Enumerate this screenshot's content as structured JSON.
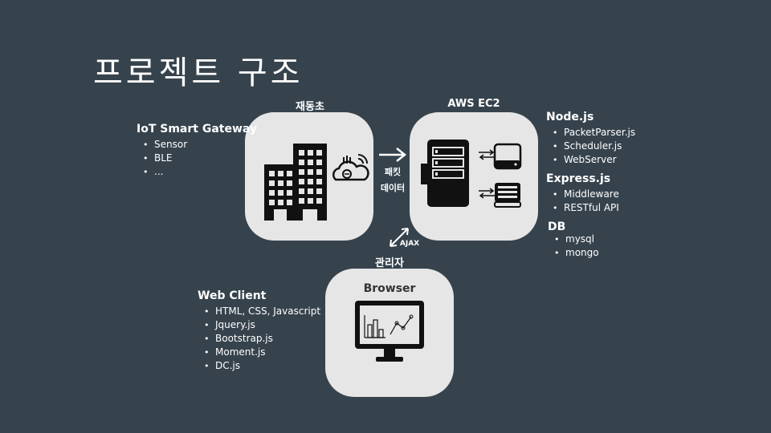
{
  "title": "프로젝트 구조",
  "nodes": {
    "gateway": {
      "label": "재동초"
    },
    "server": {
      "label": "AWS EC2"
    },
    "client": {
      "label": "관리자",
      "inner_label": "Browser"
    }
  },
  "edges": {
    "packet": {
      "line1": "패킷",
      "line2": "데이터"
    },
    "ajax": {
      "label": "AJAX"
    }
  },
  "iot": {
    "heading": "IoT Smart Gateway",
    "items": [
      "Sensor",
      "BLE",
      "..."
    ]
  },
  "nodejs": {
    "heading": "Node.js",
    "items": [
      "PacketParser.js",
      "Scheduler.js",
      "WebServer"
    ]
  },
  "express": {
    "heading": "Express.js",
    "items": [
      "Middleware",
      "RESTful API"
    ]
  },
  "db": {
    "heading": "DB",
    "items": [
      "mysql",
      "mongo"
    ]
  },
  "webclient": {
    "heading": "Web Client",
    "items": [
      "HTML, CSS, Javascript",
      "Jquery.js",
      "Bootstrap.js",
      "Moment.js",
      "DC.js"
    ]
  },
  "colors": {
    "background": "#36434d",
    "box": "#e6e6e6",
    "icon": "#111111"
  }
}
